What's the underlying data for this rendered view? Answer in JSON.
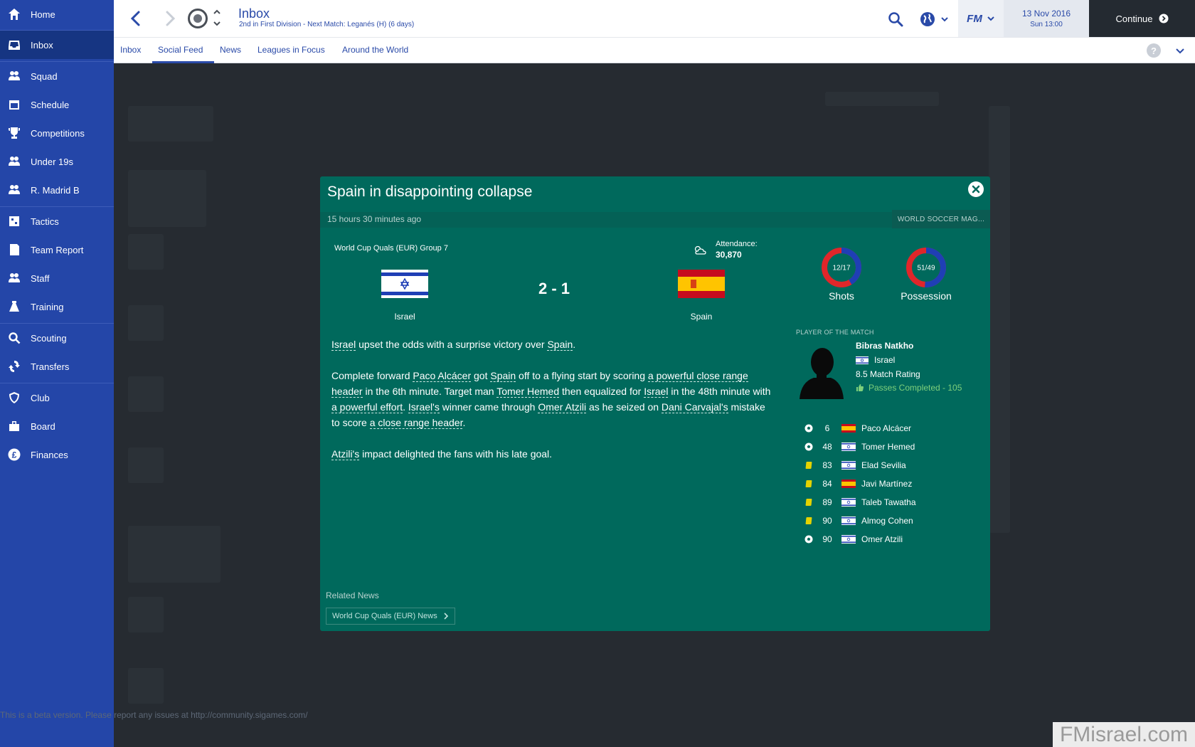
{
  "sidebar": {
    "items": [
      {
        "label": "Home",
        "icon": "home-icon"
      },
      {
        "label": "Inbox",
        "icon": "inbox-icon"
      },
      {
        "label": "Squad",
        "icon": "squad-icon"
      },
      {
        "label": "Schedule",
        "icon": "calendar-icon"
      },
      {
        "label": "Competitions",
        "icon": "trophy-icon"
      },
      {
        "label": "Under 19s",
        "icon": "under19s-icon"
      },
      {
        "label": "R. Madrid B",
        "icon": "reserve-team-icon"
      },
      {
        "label": "Tactics",
        "icon": "tactics-icon"
      },
      {
        "label": "Team Report",
        "icon": "report-icon"
      },
      {
        "label": "Staff",
        "icon": "staff-icon"
      },
      {
        "label": "Training",
        "icon": "training-icon"
      },
      {
        "label": "Scouting",
        "icon": "search-icon"
      },
      {
        "label": "Transfers",
        "icon": "transfers-icon"
      },
      {
        "label": "Club",
        "icon": "shield-icon"
      },
      {
        "label": "Board",
        "icon": "board-icon"
      },
      {
        "label": "Finances",
        "icon": "pound-icon"
      }
    ],
    "active": "Inbox"
  },
  "header": {
    "title": "Inbox",
    "subtitle": "2nd in First Division - Next Match: Leganés (H) (6 days)",
    "logo_text": "FM",
    "date": "13 Nov 2016",
    "time": "Sun 13:00",
    "continue_label": "Continue"
  },
  "tabs": [
    {
      "label": "Inbox"
    },
    {
      "label": "Social Feed",
      "active": true
    },
    {
      "label": "News"
    },
    {
      "label": "Leagues in Focus"
    },
    {
      "label": "Around the World"
    }
  ],
  "help_label": "?",
  "beta_notice": "This is a beta version. Please report any issues at http://community.sigames.com/",
  "watermark": "FMisrael.com",
  "modal": {
    "title": "Spain in disappointing collapse",
    "time_ago": "15 hours 30 minutes ago",
    "source": "WORLD SOCCER MAG...",
    "competition": "World Cup Quals (EUR) Group 7",
    "attendance_label": "Attendance:",
    "attendance_value": "30,870",
    "home_team": "Israel",
    "away_team": "Spain",
    "score": "2 - 1",
    "shots": {
      "label": "Shots",
      "value": "12/17",
      "home": 12,
      "away": 17
    },
    "possession": {
      "label": "Possession",
      "value": "51/49",
      "home": 51,
      "away": 49
    },
    "colors": {
      "home": "#1f3fb5",
      "away": "#e0262a",
      "panel": "#00695c"
    },
    "article": {
      "p1": [
        {
          "t": "Israel",
          "u": true
        },
        {
          "t": " upset the odds with a surprise victory over "
        },
        {
          "t": "Spain",
          "u": true
        },
        {
          "t": "."
        }
      ],
      "p2": [
        {
          "t": "Complete forward "
        },
        {
          "t": "Paco Alcácer",
          "u": true
        },
        {
          "t": " got "
        },
        {
          "t": "Spain",
          "u": true
        },
        {
          "t": " off to a flying start by scoring "
        },
        {
          "t": "a powerful close range header",
          "u": true
        },
        {
          "t": " in the 6th minute. Target man "
        },
        {
          "t": "Tomer Hemed",
          "u": true
        },
        {
          "t": " then equalized for "
        },
        {
          "t": "Israel",
          "u": true
        },
        {
          "t": " in the 48th minute with "
        },
        {
          "t": "a powerful effort",
          "u": true
        },
        {
          "t": ". "
        },
        {
          "t": "Israel's",
          "u": true
        },
        {
          "t": " winner came through "
        },
        {
          "t": "Omer Atzili",
          "u": true
        },
        {
          "t": " as he seized on "
        },
        {
          "t": "Dani Carvajal's",
          "u": true
        },
        {
          "t": " mistake to score "
        },
        {
          "t": "a close range header",
          "u": true
        },
        {
          "t": "."
        }
      ],
      "p3": [
        {
          "t": "Atzili's",
          "u": true
        },
        {
          "t": " impact delighted the fans with his late goal."
        }
      ]
    },
    "potm": {
      "label": "PLAYER OF THE MATCH",
      "name": "Bibras Natkho",
      "nation": "Israel",
      "rating": "8.5 Match Rating",
      "stat": "Passes Completed - 105"
    },
    "events": [
      {
        "type": "goal",
        "minute": "6",
        "nation": "Spain",
        "player": "Paco Alcácer"
      },
      {
        "type": "goal",
        "minute": "48",
        "nation": "Israel",
        "player": "Tomer Hemed"
      },
      {
        "type": "yellow",
        "minute": "83",
        "nation": "Israel",
        "player": "Elad Sevilia"
      },
      {
        "type": "yellow",
        "minute": "84",
        "nation": "Spain",
        "player": "Javi Martínez"
      },
      {
        "type": "yellow",
        "minute": "89",
        "nation": "Israel",
        "player": "Taleb Tawatha"
      },
      {
        "type": "yellow",
        "minute": "90",
        "nation": "Israel",
        "player": "Almog Cohen"
      },
      {
        "type": "goal",
        "minute": "90",
        "nation": "Israel",
        "player": "Omer Atzili"
      }
    ],
    "related_label": "Related News",
    "related_link": "World Cup Quals (EUR) News"
  }
}
